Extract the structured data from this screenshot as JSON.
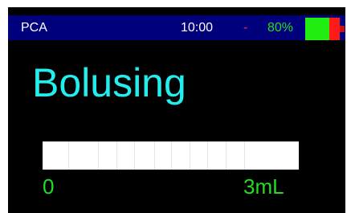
{
  "header": {
    "app_name": "PCA",
    "time": "10:00",
    "separator": "-",
    "battery_percent": "80%",
    "battery_level": 0.8
  },
  "main": {
    "status": "Bolusing"
  },
  "progress": {
    "min_label": "0",
    "max_label": "3mL",
    "fraction_delivered": 1.0
  },
  "colors": {
    "status_bar_bg": "#00007d",
    "screen_bg": "#000000",
    "status_text": "#22eeee",
    "range_text": "#22dd22",
    "battery_green": "#22ee11",
    "battery_red": "#ff1a1a"
  }
}
